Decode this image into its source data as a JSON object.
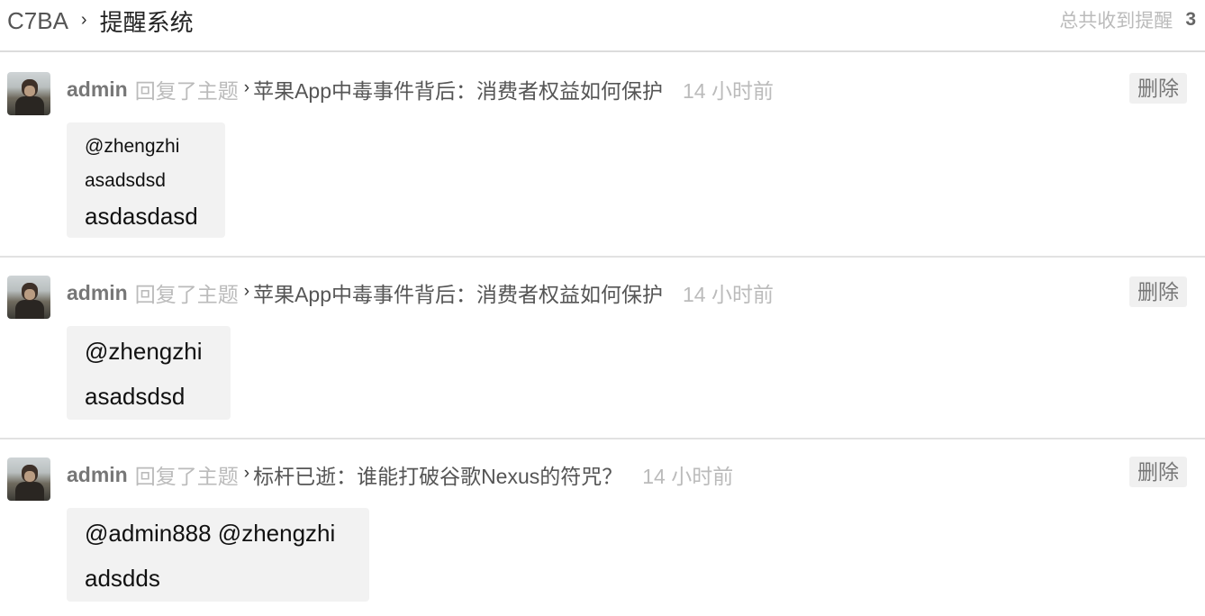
{
  "header": {
    "site_name": "C7BA",
    "separator": "›",
    "current": "提醒系统",
    "total_label": "总共收到提醒",
    "total_count": "3"
  },
  "notifications": [
    {
      "user": "admin",
      "action": "回复了主题",
      "arrow": "›",
      "topic": "苹果App中毒事件背后：消费者权益如何保护",
      "time": "14 小时前",
      "delete_label": "删除",
      "content": [
        "@zhengzhi",
        "asadsdsd",
        "asdasdasd"
      ]
    },
    {
      "user": "admin",
      "action": "回复了主题",
      "arrow": "›",
      "topic": "苹果App中毒事件背后：消费者权益如何保护",
      "time": "14 小时前",
      "delete_label": "删除",
      "content": [
        "@zhengzhi",
        "asadsdsd"
      ]
    },
    {
      "user": "admin",
      "action": "回复了主题",
      "arrow": "›",
      "topic": "标杆已逝：谁能打破谷歌Nexus的符咒？",
      "time": "14 小时前",
      "delete_label": "删除",
      "content": [
        "@admin888 @zhengzhi",
        "adsdds"
      ]
    }
  ]
}
